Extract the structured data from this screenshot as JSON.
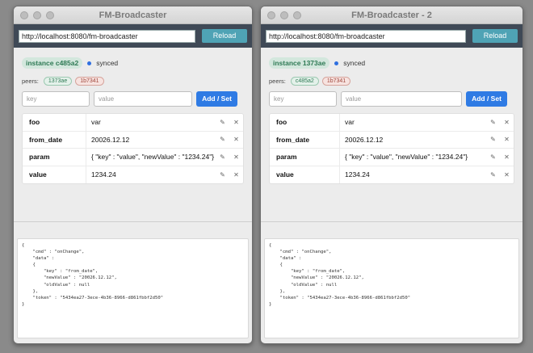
{
  "windows": [
    {
      "title": "FM-Broadcaster",
      "url": "http://localhost:8080/fm-broadcaster",
      "reload_label": "Reload",
      "instance_badge": "instance c485a2",
      "status": "synced",
      "peers_label": "peers:",
      "peers": [
        {
          "id": "1373ae",
          "color": "green"
        },
        {
          "id": "1b7341",
          "color": "red"
        }
      ],
      "key_placeholder": "key",
      "value_placeholder": "value",
      "set_label": "Add / Set",
      "rows": [
        {
          "key": "foo",
          "value": "var"
        },
        {
          "key": "from_date",
          "value": "20026.12.12"
        },
        {
          "key": "param",
          "value": "{ \"key\" : \"value\", \"newValue\" : \"1234.24\"}"
        },
        {
          "key": "value",
          "value": "1234.24"
        }
      ],
      "edit_icon": "pencil-icon",
      "delete_icon": "close-icon",
      "log": "{\n    \"cmd\" : \"onChange\",\n    \"data\" :\n    {\n        \"key\" : \"from_date\",\n        \"newValue\" : \"20026.12.12\",\n        \"oldValue\" : null\n    },\n    \"token\" : \"5434ea27-3ece-4b36-8966-d861fbbf2d50\"\n}"
    },
    {
      "title": "FM-Broadcaster - 2",
      "url": "http://localhost:8080/fm-broadcaster",
      "reload_label": "Reload",
      "instance_badge": "instance 1373ae",
      "status": "synced",
      "peers_label": "peers:",
      "peers": [
        {
          "id": "c485a2",
          "color": "green"
        },
        {
          "id": "1b7341",
          "color": "red"
        }
      ],
      "key_placeholder": "key",
      "value_placeholder": "value",
      "set_label": "Add / Set",
      "rows": [
        {
          "key": "foo",
          "value": "var"
        },
        {
          "key": "from_date",
          "value": "20026.12.12"
        },
        {
          "key": "param",
          "value": "{ \"key\" : \"value\", \"newValue\" : \"1234.24\"}"
        },
        {
          "key": "value",
          "value": "1234.24"
        }
      ],
      "edit_icon": "pencil-icon",
      "delete_icon": "close-icon",
      "log": "{\n    \"cmd\" : \"onChange\",\n    \"data\" :\n    {\n        \"key\" : \"from_date\",\n        \"newValue\" : \"20026.12.12\",\n        \"oldValue\" : null\n    },\n    \"token\" : \"5434ea27-3ece-4b36-8966-d861fbbf2d50\"\n}"
    }
  ],
  "colors": {
    "accent": "#2f7be4",
    "reload": "#4fa3b5",
    "urlbar": "#3f4956",
    "synced_dot": "#2f6fe0"
  }
}
